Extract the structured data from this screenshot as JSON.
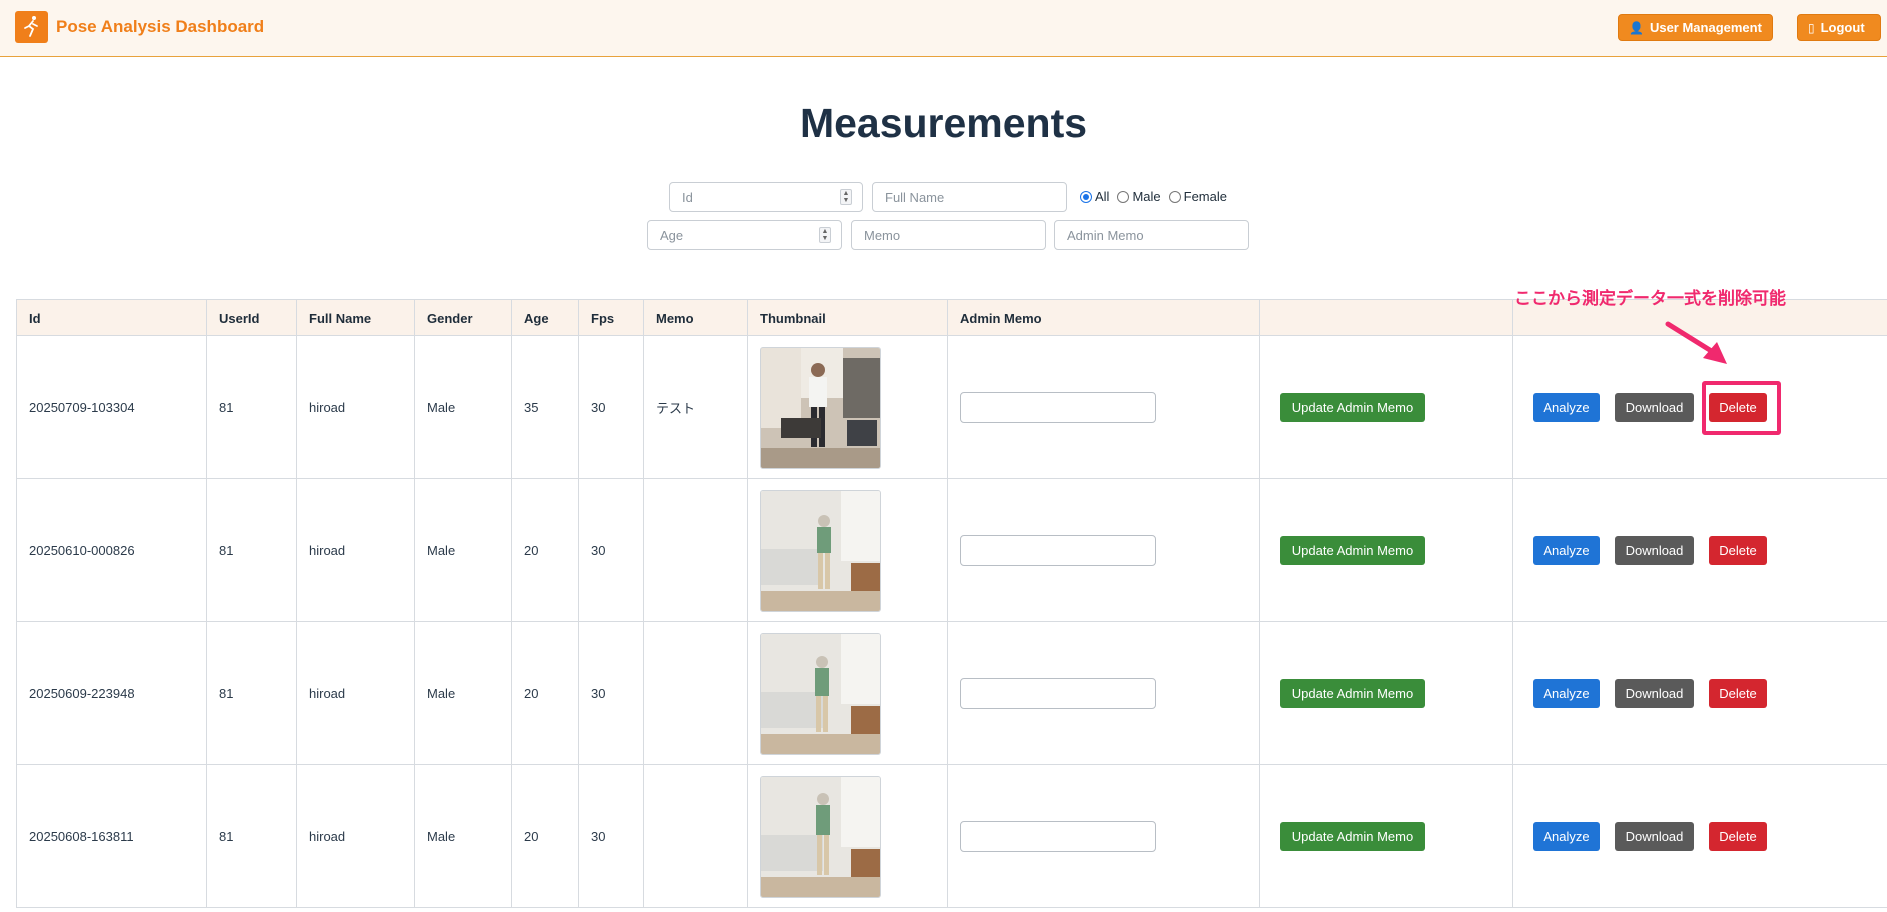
{
  "header": {
    "title": "Pose Analysis Dashboard",
    "user_management": "User Management",
    "logout": "Logout"
  },
  "page": {
    "title": "Measurements"
  },
  "filters": {
    "id_placeholder": "Id",
    "fullname_placeholder": "Full Name",
    "age_placeholder": "Age",
    "memo_placeholder": "Memo",
    "admin_memo_placeholder": "Admin Memo",
    "gender_options": [
      "All",
      "Male",
      "Female"
    ],
    "gender_selected": "All"
  },
  "table": {
    "columns": [
      "Id",
      "UserId",
      "Full Name",
      "Gender",
      "Age",
      "Fps",
      "Memo",
      "Thumbnail",
      "Admin Memo",
      "",
      ""
    ],
    "rows": [
      {
        "id": "20250709-103304",
        "userid": "81",
        "fullname": "hiroad",
        "gender": "Male",
        "age": "35",
        "fps": "30",
        "memo": "テスト",
        "admin_memo": ""
      },
      {
        "id": "20250610-000826",
        "userid": "81",
        "fullname": "hiroad",
        "gender": "Male",
        "age": "20",
        "fps": "30",
        "memo": "",
        "admin_memo": ""
      },
      {
        "id": "20250609-223948",
        "userid": "81",
        "fullname": "hiroad",
        "gender": "Male",
        "age": "20",
        "fps": "30",
        "memo": "",
        "admin_memo": ""
      },
      {
        "id": "20250608-163811",
        "userid": "81",
        "fullname": "hiroad",
        "gender": "Male",
        "age": "20",
        "fps": "30",
        "memo": "",
        "admin_memo": ""
      }
    ],
    "buttons": {
      "update_admin_memo": "Update Admin Memo",
      "analyze": "Analyze",
      "download": "Download",
      "delete": "Delete"
    }
  },
  "annotation": {
    "text": "ここから測定データ一式を削除可能"
  },
  "colors": {
    "accent": "#f07f1a",
    "annotation": "#f0296e",
    "delete": "#d4262f",
    "analyze": "#1f74d6",
    "update": "#3a8d3a"
  }
}
